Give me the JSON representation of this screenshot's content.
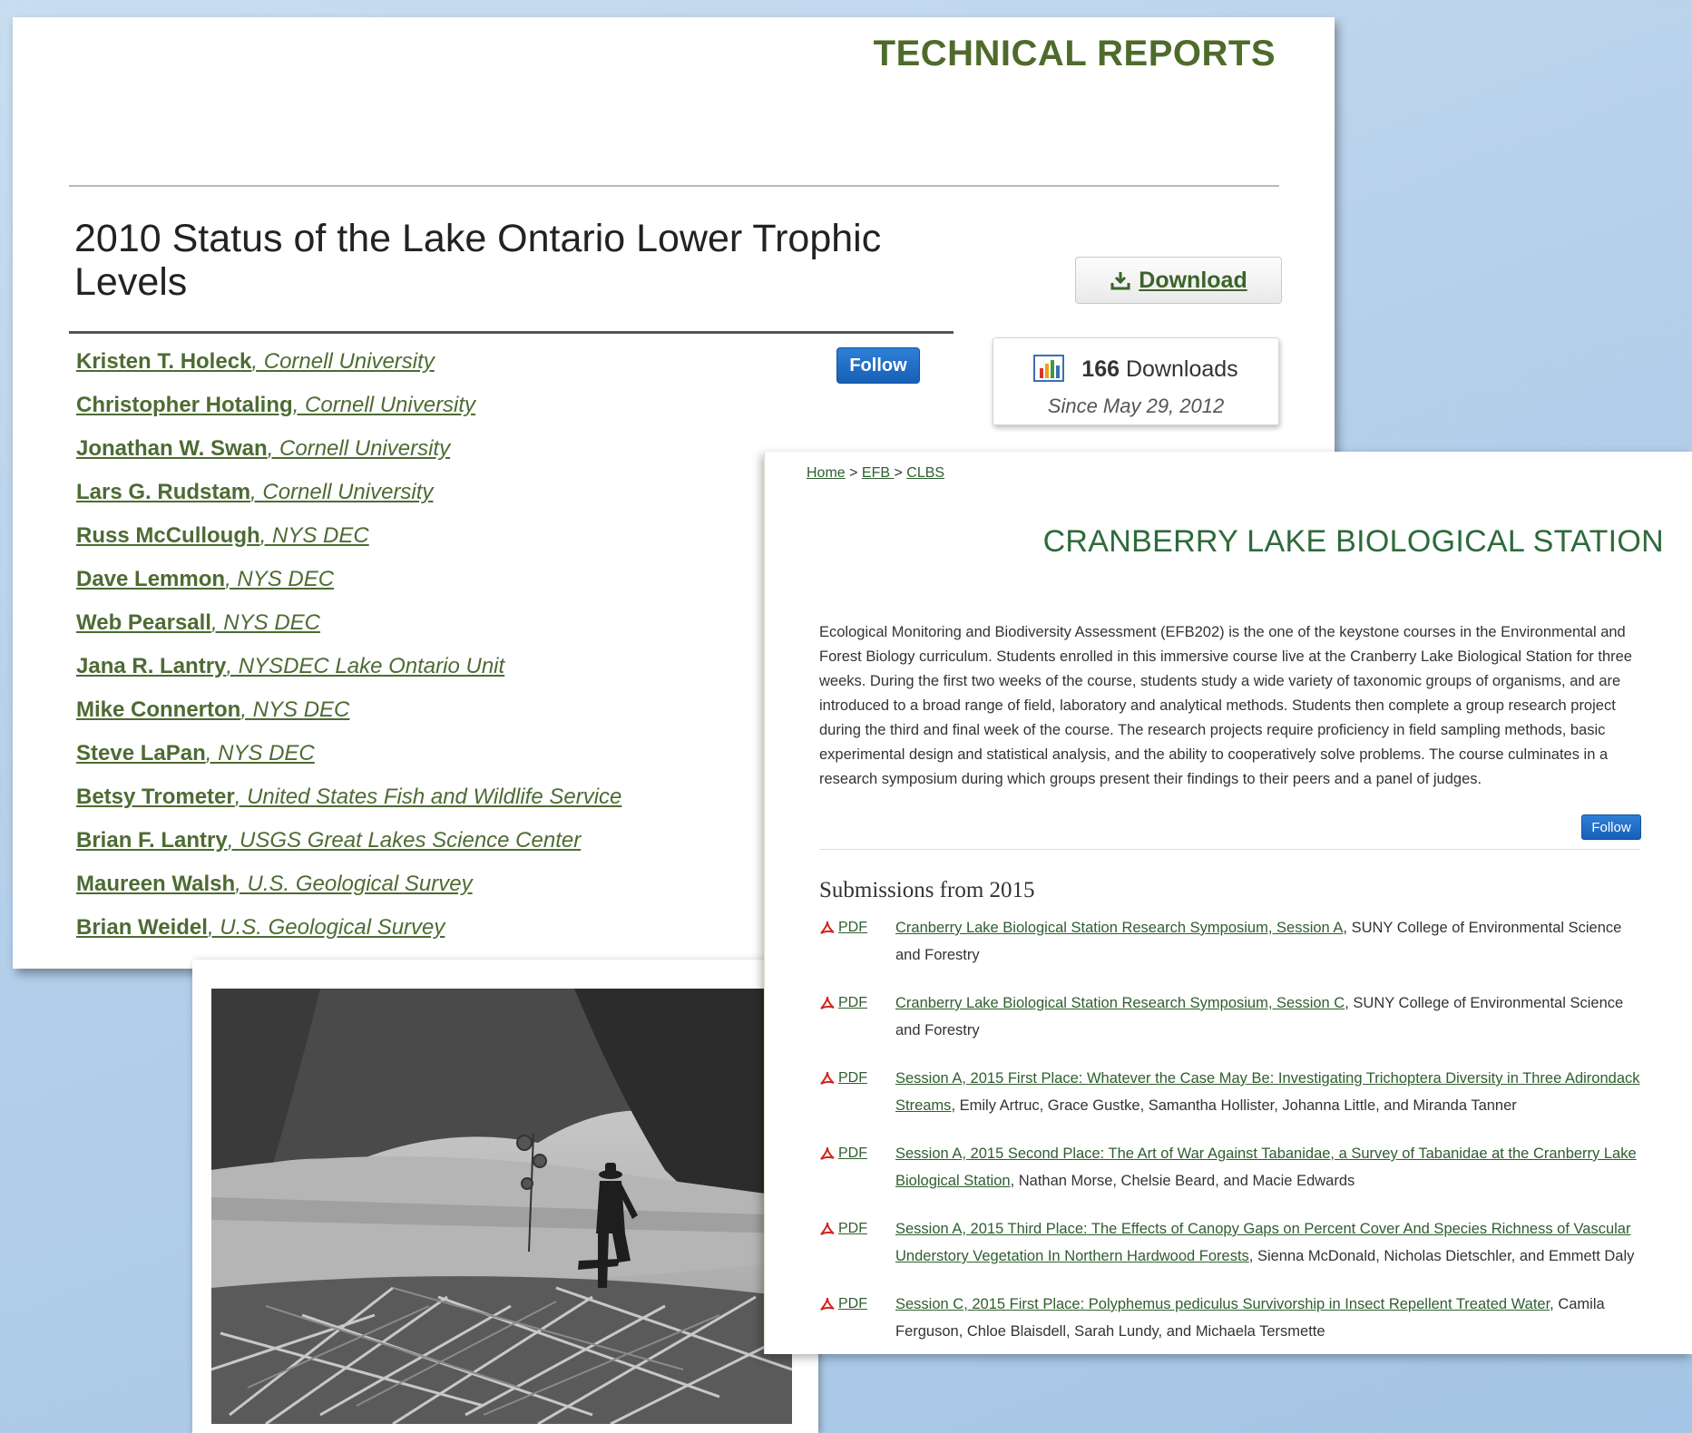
{
  "report": {
    "section_heading": "TECHNICAL REPORTS",
    "title": "2010 Status of the Lake Ontario Lower Trophic Levels",
    "download_label": "Download",
    "follow_label": "Follow",
    "downloads_count": "166",
    "downloads_word": "Downloads",
    "downloads_since": "Since May 29, 2012",
    "authors": [
      {
        "name": "Kristen T. Holeck",
        "affiliation": ", Cornell University"
      },
      {
        "name": "Christopher Hotaling",
        "affiliation": ", Cornell University"
      },
      {
        "name": "Jonathan W. Swan",
        "affiliation": ", Cornell University"
      },
      {
        "name": "Lars G. Rudstam",
        "affiliation": ", Cornell University"
      },
      {
        "name": "Russ McCullough",
        "affiliation": ", NYS DEC"
      },
      {
        "name": "Dave Lemmon",
        "affiliation": ", NYS DEC"
      },
      {
        "name": "Web Pearsall",
        "affiliation": ", NYS DEC"
      },
      {
        "name": "Jana R. Lantry",
        "affiliation": ", NYSDEC Lake Ontario Unit"
      },
      {
        "name": "Mike Connerton",
        "affiliation": ", NYS DEC"
      },
      {
        "name": "Steve LaPan",
        "affiliation": ", NYS DEC"
      },
      {
        "name": "Betsy Trometer",
        "affiliation": ", United States Fish and Wildlife Service"
      },
      {
        "name": "Brian F. Lantry",
        "affiliation": ", USGS Great Lakes Science Center"
      },
      {
        "name": "Maureen Walsh",
        "affiliation": ", U.S. Geological Survey"
      },
      {
        "name": "Brian Weidel",
        "affiliation": ", U.S. Geological Survey"
      }
    ],
    "icons": {
      "download": "download-icon",
      "stats": "bar-chart-icon"
    },
    "colors": {
      "heading": "#4e6b2c",
      "follow": "#1d6fc8"
    }
  },
  "clbs": {
    "breadcrumb": {
      "home": "Home",
      "sep1": " > ",
      "efb": "EFB ",
      "sep2": " > ",
      "clbs": "CLBS"
    },
    "title": "CRANBERRY LAKE BIOLOGICAL STATION",
    "description": "Ecological Monitoring and Biodiversity Assessment (EFB202) is the one of the keystone courses in the Environmental and Forest Biology curriculum. Students enrolled in this immersive course live at the Cranberry Lake Biological Station for three weeks. During the first two weeks of the course, students study a wide variety of taxonomic groups of organisms, and are introduced to a broad range of field, laboratory and analytical methods. Students then complete a group research project during the third and final week of the course. The research projects require proficiency in field sampling methods, basic experimental design and statistical analysis, and the ability to cooperatively solve problems. The course culminates in a research symposium during which groups present their findings to their peers and a panel of judges.",
    "follow_label": "Follow",
    "submissions_heading": "Submissions from 2015",
    "pdf_label": "PDF",
    "submissions": [
      {
        "title": "Cranberry Lake Biological Station Research Symposium, Session A",
        "rest": ", SUNY College of Environmental Science and Forestry"
      },
      {
        "title": "Cranberry Lake Biological Station Research Symposium, Session C",
        "rest": ", SUNY College of Environmental Science and Forestry"
      },
      {
        "title": "Session A, 2015 First Place: Whatever the Case May Be: Investigating Trichoptera Diversity in Three Adirondack Streams",
        "rest": ", Emily Artruc, Grace Gustke, Samantha Hollister, Johanna Little, and Miranda Tanner"
      },
      {
        "title": "Session A, 2015 Second Place: The Art of War Against Tabanidae, a Survey of Tabanidae at the Cranberry Lake Biological Station",
        "rest": ", Nathan Morse, Chelsie Beard, and Macie Edwards"
      },
      {
        "title": "Session A, 2015 Third Place: The Effects of Canopy Gaps on Percent Cover And Species Richness of Vascular Understory Vegetation In Northern Hardwood Forests",
        "rest": ", Sienna McDonald, Nicholas Dietschler, and Emmett Daly"
      },
      {
        "title": "Session C, 2015 First Place: Polyphemus pediculus Survivorship in Insect Repellent Treated Water",
        "rest": ", Camila Ferguson, Chloe Blaisdell, Sarah Lundy, and Michaela Tersmette"
      }
    ],
    "icons": {
      "pdf": "pdf-icon"
    },
    "colors": {
      "title": "#2d6a3a",
      "link": "#2e5e2e"
    }
  }
}
